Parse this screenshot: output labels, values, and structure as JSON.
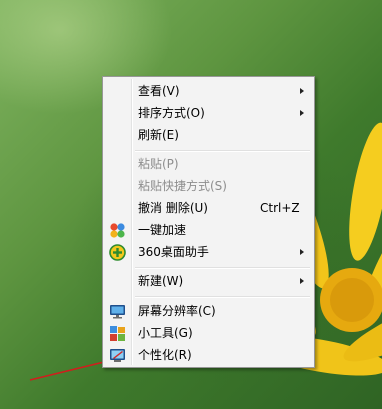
{
  "menu": {
    "items": [
      {
        "label": "查看(V)",
        "submenu": true
      },
      {
        "label": "排序方式(O)",
        "submenu": true
      },
      {
        "label": "刷新(E)"
      },
      {
        "label": "粘贴(P)",
        "disabled": true
      },
      {
        "label": "粘贴快捷方式(S)",
        "disabled": true
      },
      {
        "label": "撤消 删除(U)",
        "shortcut": "Ctrl+Z"
      },
      {
        "label": "一键加速",
        "icon": "speedup-icon"
      },
      {
        "label": "360桌面助手",
        "icon": "360-desktop-assistant-icon",
        "submenu": true
      },
      {
        "label": "新建(W)",
        "submenu": true
      },
      {
        "label": "屏幕分辨率(C)",
        "icon": "monitor-icon"
      },
      {
        "label": "小工具(G)",
        "icon": "gadgets-icon"
      },
      {
        "label": "个性化(R)",
        "icon": "personalize-icon"
      }
    ]
  }
}
